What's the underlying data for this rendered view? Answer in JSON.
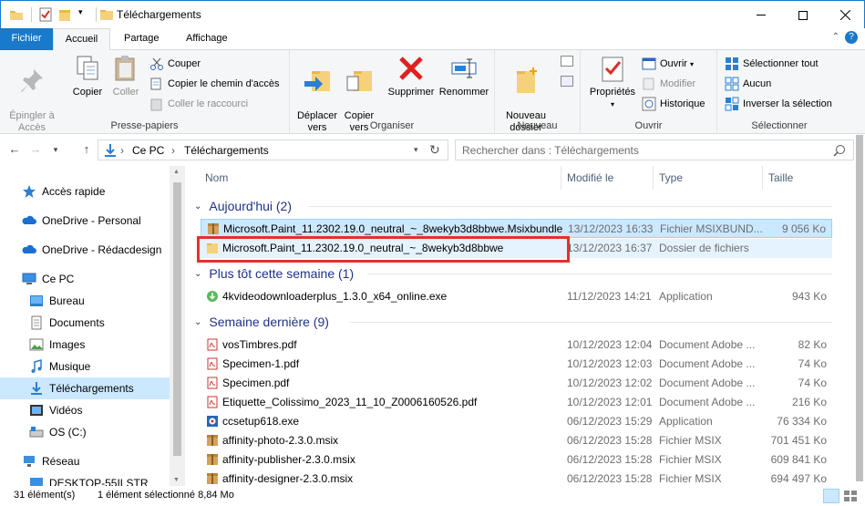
{
  "window": {
    "title": "Téléchargements"
  },
  "ribbon_tabs": [
    "Fichier",
    "Accueil",
    "Partage",
    "Affichage"
  ],
  "ribbon": {
    "presse_papiers": {
      "label": "Presse-papiers",
      "pin": "Épingler à\nAccès rapide",
      "copy": "Copier",
      "paste": "Coller",
      "cut": "Couper",
      "copy_path": "Copier le chemin d'accès",
      "paste_shortcut": "Coller le raccourci"
    },
    "organiser": {
      "label": "Organiser",
      "move_to": "Déplacer\nvers",
      "copy_to": "Copier\nvers",
      "delete": "Supprimer",
      "rename": "Renommer"
    },
    "nouveau": {
      "label": "Nouveau",
      "new_folder": "Nouveau\ndossier"
    },
    "ouvrir": {
      "label": "Ouvrir",
      "properties": "Propriétés",
      "open": "Ouvrir",
      "edit": "Modifier",
      "history": "Historique"
    },
    "selectionner": {
      "label": "Sélectionner",
      "select_all": "Sélectionner tout",
      "select_none": "Aucun",
      "invert": "Inverser la sélection"
    }
  },
  "address": {
    "segments": [
      "Ce PC",
      "Téléchargements"
    ],
    "search_placeholder": "Rechercher dans : Téléchargements"
  },
  "nav": {
    "items": [
      {
        "label": "Accès rapide",
        "icon": "star-icon"
      },
      {
        "label": "OneDrive - Personal",
        "icon": "cloud-icon"
      },
      {
        "label": "OneDrive - Rédacdesign",
        "icon": "cloud-icon"
      },
      {
        "label": "Ce PC",
        "icon": "computer-icon"
      },
      {
        "label": "Bureau",
        "icon": "desktop-icon"
      },
      {
        "label": "Documents",
        "icon": "document-icon"
      },
      {
        "label": "Images",
        "icon": "image-icon"
      },
      {
        "label": "Musique",
        "icon": "music-icon"
      },
      {
        "label": "Téléchargements",
        "icon": "download-icon"
      },
      {
        "label": "Vidéos",
        "icon": "video-icon"
      },
      {
        "label": "OS (C:)",
        "icon": "drive-icon"
      },
      {
        "label": "Réseau",
        "icon": "network-icon"
      },
      {
        "label": "DESKTOP-55ILSTR",
        "icon": "computer-icon"
      }
    ]
  },
  "columns": [
    "Nom",
    "Modifié le",
    "Type",
    "Taille"
  ],
  "groups": [
    {
      "title": "Aujourd'hui (2)",
      "files": [
        {
          "name": "Microsoft.Paint_11.2302.19.0_neutral_~_8wekyb3d8bbwe.Msixbundle",
          "date": "13/12/2023 16:33",
          "type": "Fichier MSIXBUND...",
          "size": "9 056 Ko",
          "icon": "package-icon"
        },
        {
          "name": "Microsoft.Paint_11.2302.19.0_neutral_~_8wekyb3d8bbwe",
          "date": "13/12/2023 16:37",
          "type": "Dossier de fichiers",
          "size": "",
          "icon": "folder-icon"
        }
      ]
    },
    {
      "title": "Plus tôt cette semaine (1)",
      "files": [
        {
          "name": "4kvideodownloaderplus_1.3.0_x64_online.exe",
          "date": "11/12/2023 14:21",
          "type": "Application",
          "size": "943 Ko",
          "icon": "app-icon"
        }
      ]
    },
    {
      "title": "Semaine dernière (9)",
      "files": [
        {
          "name": "vosTimbres.pdf",
          "date": "10/12/2023 12:04",
          "type": "Document Adobe ...",
          "size": "82 Ko",
          "icon": "pdf-icon"
        },
        {
          "name": "Specimen-1.pdf",
          "date": "10/12/2023 12:03",
          "type": "Document Adobe ...",
          "size": "74 Ko",
          "icon": "pdf-icon"
        },
        {
          "name": "Specimen.pdf",
          "date": "10/12/2023 12:02",
          "type": "Document Adobe ...",
          "size": "74 Ko",
          "icon": "pdf-icon"
        },
        {
          "name": "Etiquette_Colissimo_2023_11_10_Z0006160526.pdf",
          "date": "10/12/2023 12:01",
          "type": "Document Adobe ...",
          "size": "216 Ko",
          "icon": "pdf-icon"
        },
        {
          "name": "ccsetup618.exe",
          "date": "06/12/2023 15:29",
          "type": "Application",
          "size": "76 334 Ko",
          "icon": "installer-icon"
        },
        {
          "name": "affinity-photo-2.3.0.msix",
          "date": "06/12/2023 15:28",
          "type": "Fichier MSIX",
          "size": "701 451 Ko",
          "icon": "package-icon"
        },
        {
          "name": "affinity-publisher-2.3.0.msix",
          "date": "06/12/2023 15:28",
          "type": "Fichier MSIX",
          "size": "609 841 Ko",
          "icon": "package-icon"
        },
        {
          "name": "affinity-designer-2.3.0.msix",
          "date": "06/12/2023 15:28",
          "type": "Fichier MSIX",
          "size": "694 497 Ko",
          "icon": "package-icon"
        }
      ]
    }
  ],
  "status": {
    "count": "31 élément(s)",
    "selected": "1 élément sélectionné  8,84 Mo"
  },
  "colors": {
    "accent": "#1979ca",
    "selection": "#cce8ff",
    "highlight_box": "#e03131",
    "group_title": "#1e3287"
  }
}
